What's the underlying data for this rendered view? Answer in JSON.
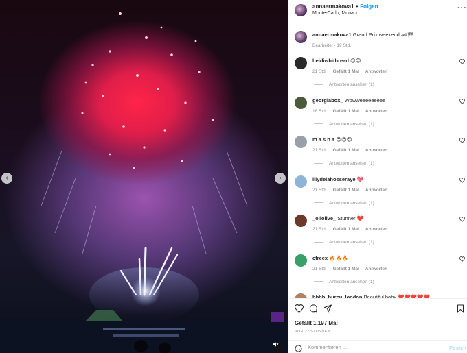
{
  "post": {
    "username": "annaermakova1",
    "separator": "•",
    "follow_label": "Folgen",
    "location": "Monte-Carlo, Monaco",
    "more_icon": "more-icon"
  },
  "caption": {
    "username": "annaermakova1",
    "text": "Grand Prix weekend 🏎🏁",
    "meta": "Bearbeitet · 19 Std."
  },
  "comments": [
    {
      "username": "heidiwhitbread",
      "text": "😍😍",
      "time": "21 Std.",
      "likes": "Gefällt 1 Mal",
      "reply": "Antworten",
      "view_replies": "Antworten ansehen (1)",
      "avatar_color": "#2a2a2a"
    },
    {
      "username": "georgiabox_",
      "text": "Wowweeeeeeeee",
      "time": "18 Std.",
      "likes": "Gefällt 1 Mal",
      "reply": "Antworten",
      "view_replies": "Antworten ansehen (1)",
      "avatar_color": "#4a5a3a"
    },
    {
      "username": "m.a.s.h.a",
      "text": "😍😍😍",
      "time": "21 Std.",
      "likes": "Gefällt 1 Mal",
      "reply": "Antworten",
      "view_replies": "Antworten ansehen (1)",
      "avatar_color": "#9aa0a8"
    },
    {
      "username": "lilydelahosseraye",
      "text": "💖",
      "time": "21 Std.",
      "likes": "Gefällt 1 Mal",
      "reply": "Antworten",
      "view_replies": "Antworten ansehen (1)",
      "avatar_color": "#8fb4d8"
    },
    {
      "username": "_oliolive_",
      "text": "Stunner ❤️",
      "time": "21 Std.",
      "likes": "Gefällt 1 Mal",
      "reply": "Antworten",
      "view_replies": "Antworten ansehen (1)",
      "avatar_color": "#6b3a2a"
    },
    {
      "username": "cfreex",
      "text": "🔥🔥🔥",
      "time": "21 Std.",
      "likes": "Gefällt 1 Mal",
      "reply": "Antworten",
      "view_replies": "Antworten ansehen (1)",
      "avatar_color": "#3aa06a"
    },
    {
      "username": "bbbb_burcu_london",
      "text": "Beautiful baby ❤️❤️❤️❤️❤️",
      "time": "",
      "likes": "",
      "reply": "",
      "view_replies": "",
      "avatar_color": "#b08060"
    }
  ],
  "actions": {
    "likes_text": "Gefällt 1.197 Mal",
    "posted": "VOR 22 STUNDEN",
    "comment_placeholder": "Kommentieren ...",
    "post_label": "Posten"
  },
  "colors": {
    "accent": "#0095f6",
    "post_disabled": "#b2dffc",
    "secondary_text": "#8e8e8e"
  }
}
